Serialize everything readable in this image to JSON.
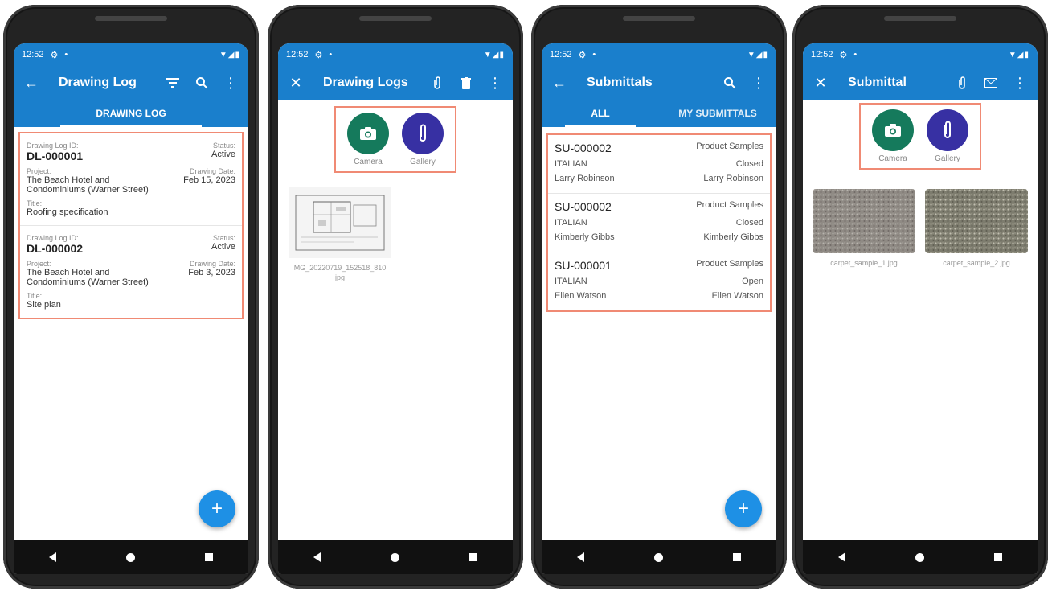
{
  "status_time": "12:52",
  "colors": {
    "primary": "#1a7fcc",
    "fab": "#1e90e5",
    "camera": "#157a5c",
    "gallery": "#3730a3",
    "highlight": "#f08a74"
  },
  "screen1": {
    "title": "Drawing Log",
    "tab": "DRAWING LOG",
    "labels": {
      "id": "Drawing Log ID:",
      "status": "Status:",
      "project": "Project:",
      "date": "Drawing Date:",
      "title": "Title:"
    },
    "items": [
      {
        "id": "DL-000001",
        "status": "Active",
        "project": "The Beach Hotel and Condominiums (Warner Street)",
        "date": "Feb 15, 2023",
        "title": "Roofing specification"
      },
      {
        "id": "DL-000002",
        "status": "Active",
        "project": "The Beach Hotel and Condominiums (Warner Street)",
        "date": "Feb 3, 2023",
        "title": "Site plan"
      }
    ]
  },
  "screen2": {
    "title": "Drawing Logs",
    "camera": "Camera",
    "gallery": "Gallery",
    "file": "IMG_20220719_152518_810.jpg"
  },
  "screen3": {
    "title": "Submittals",
    "tabs": [
      "ALL",
      "MY SUBMITTALS"
    ],
    "items": [
      {
        "id": "SU-000002",
        "type": "Product Samples",
        "company": "ITALIAN",
        "status": "Closed",
        "person_left": "Larry Robinson",
        "person_right": "Larry Robinson"
      },
      {
        "id": "SU-000002",
        "type": "Product Samples",
        "company": "ITALIAN",
        "status": "Closed",
        "person_left": "Kimberly Gibbs",
        "person_right": "Kimberly Gibbs"
      },
      {
        "id": "SU-000001",
        "type": "Product Samples",
        "company": "ITALIAN",
        "status": "Open",
        "person_left": "Ellen Watson",
        "person_right": "Ellen Watson"
      }
    ]
  },
  "screen4": {
    "title": "Submittal",
    "camera": "Camera",
    "gallery": "Gallery",
    "files": [
      "carpet_sample_1.jpg",
      "carpet_sample_2.jpg"
    ]
  }
}
